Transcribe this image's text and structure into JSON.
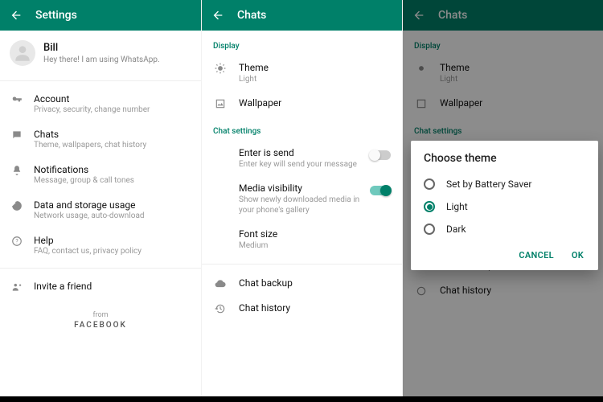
{
  "colors": {
    "primary": "#008069"
  },
  "pane1": {
    "title": "Settings",
    "profile": {
      "name": "Bill",
      "status": "Hey there! I am using WhatsApp."
    },
    "items": [
      {
        "icon": "key-icon",
        "title": "Account",
        "sub": "Privacy, security, change number"
      },
      {
        "icon": "chat-icon",
        "title": "Chats",
        "sub": "Theme, wallpapers, chat history"
      },
      {
        "icon": "bell-icon",
        "title": "Notifications",
        "sub": "Message, group & call tones"
      },
      {
        "icon": "data-icon",
        "title": "Data and storage usage",
        "sub": "Network usage, auto-download"
      },
      {
        "icon": "help-icon",
        "title": "Help",
        "sub": "FAQ, contact us, privacy policy"
      },
      {
        "icon": "invite-icon",
        "title": "Invite a friend",
        "sub": ""
      }
    ],
    "from": {
      "label": "from",
      "brand": "FACEBOOK"
    }
  },
  "pane2": {
    "title": "Chats",
    "sections": {
      "display": {
        "label": "Display",
        "theme": {
          "title": "Theme",
          "value": "Light"
        },
        "wallpaper": {
          "title": "Wallpaper"
        }
      },
      "chat": {
        "label": "Chat settings",
        "enter": {
          "title": "Enter is send",
          "sub": "Enter key will send your message",
          "on": false
        },
        "media": {
          "title": "Media visibility",
          "sub": "Show newly downloaded media in your phone's gallery",
          "on": true
        },
        "font": {
          "title": "Font size",
          "value": "Medium"
        },
        "backup": {
          "title": "Chat backup"
        },
        "history": {
          "title": "Chat history"
        }
      }
    }
  },
  "pane3": {
    "title": "Chats",
    "dialog": {
      "title": "Choose theme",
      "options": [
        {
          "label": "Set by Battery Saver",
          "selected": false
        },
        {
          "label": "Light",
          "selected": true
        },
        {
          "label": "Dark",
          "selected": false
        }
      ],
      "cancel": "CANCEL",
      "ok": "OK"
    }
  }
}
